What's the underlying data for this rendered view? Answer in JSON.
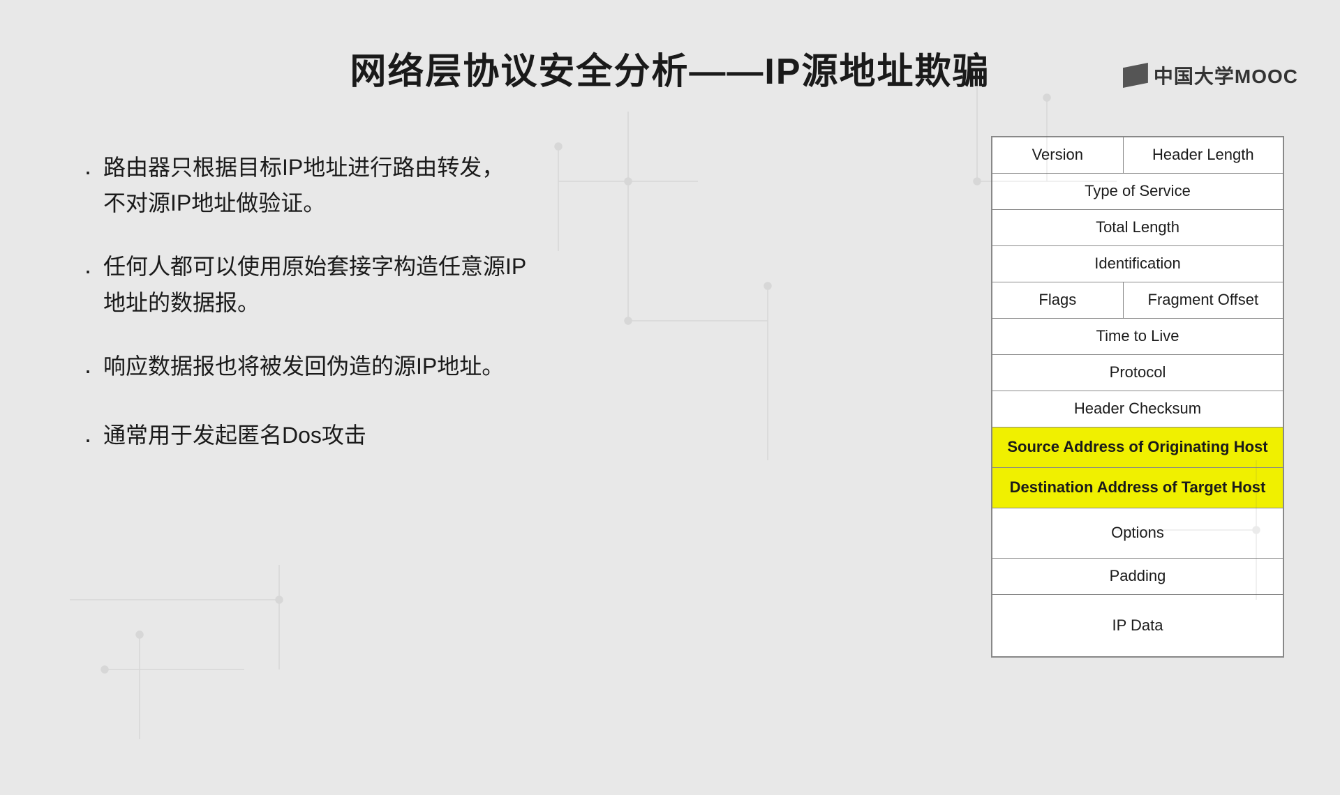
{
  "logo": {
    "text": "中国大学MOOC"
  },
  "title": "网络层协议安全分析——IP源地址欺骗",
  "bullets": [
    {
      "text": "路由器只根据目标IP地址进行路由转发，\n不对源IP地址做验证。"
    },
    {
      "text": "任何人都可以使用原始套接字构造任意源IP\n地址的数据报。"
    },
    {
      "text": "响应数据报也将被发回伪造的源IP地址。"
    },
    {
      "text": "通常用于发起匿名Dos攻击"
    }
  ],
  "ip_header_table": {
    "rows": [
      {
        "type": "split",
        "left": "Version",
        "right": "Header Length",
        "highlight": false
      },
      {
        "type": "full",
        "text": "Type of Service",
        "highlight": false
      },
      {
        "type": "full",
        "text": "Total Length",
        "highlight": false
      },
      {
        "type": "full",
        "text": "Identification",
        "highlight": false
      },
      {
        "type": "split",
        "left": "Flags",
        "right": "Fragment Offset",
        "highlight": false
      },
      {
        "type": "full",
        "text": "Time to Live",
        "highlight": false
      },
      {
        "type": "full",
        "text": "Protocol",
        "highlight": false
      },
      {
        "type": "full",
        "text": "Header Checksum",
        "highlight": false
      },
      {
        "type": "full",
        "text": "Source Address of Originating Host",
        "highlight": true
      },
      {
        "type": "full",
        "text": "Destination Address of Target Host",
        "highlight": true
      },
      {
        "type": "full",
        "text": "Options",
        "highlight": false,
        "tall": true
      },
      {
        "type": "full",
        "text": "Padding",
        "highlight": false
      },
      {
        "type": "full",
        "text": "IP Data",
        "highlight": false,
        "extratall": true
      }
    ]
  }
}
